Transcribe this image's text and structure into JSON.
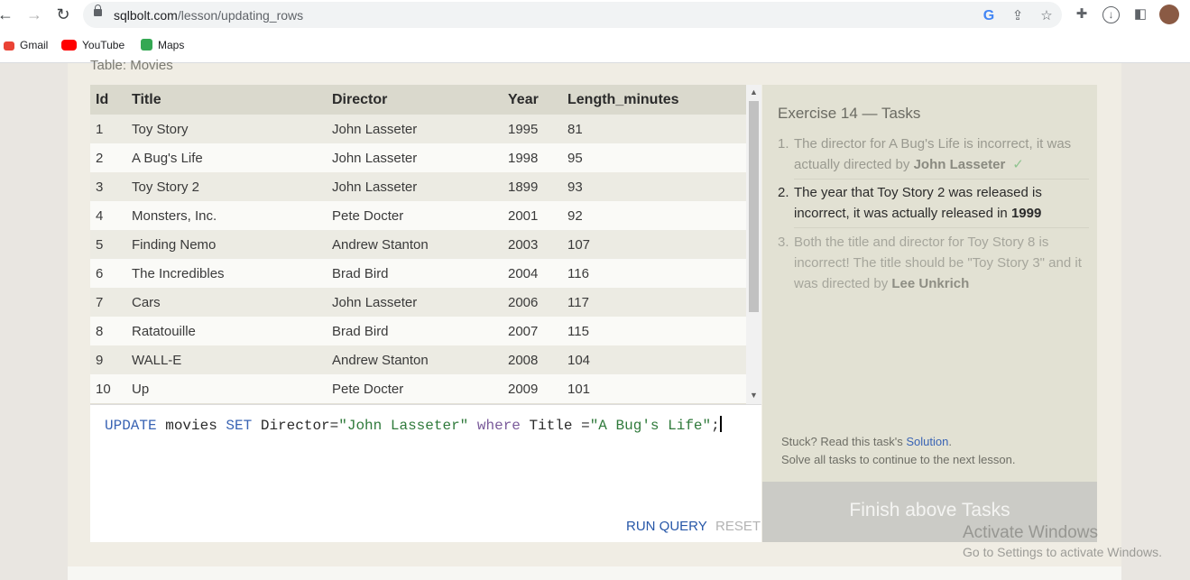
{
  "browser": {
    "url_domain": "sqlbolt.com",
    "url_path": "/lesson/updating_rows",
    "bookmarks": [
      {
        "label": "Gmail",
        "icon": "gmail-icon",
        "color": "#ea4335"
      },
      {
        "label": "YouTube",
        "icon": "youtube-icon",
        "color": "#ff0000"
      },
      {
        "label": "Maps",
        "icon": "maps-icon",
        "color": "#34a853"
      }
    ]
  },
  "table": {
    "label": "Table: Movies",
    "columns": [
      "Id",
      "Title",
      "Director",
      "Year",
      "Length_minutes"
    ],
    "rows": [
      [
        "1",
        "Toy Story",
        "John Lasseter",
        "1995",
        "81"
      ],
      [
        "2",
        "A Bug's Life",
        "John Lasseter",
        "1998",
        "95"
      ],
      [
        "3",
        "Toy Story 2",
        "John Lasseter",
        "1899",
        "93"
      ],
      [
        "4",
        "Monsters, Inc.",
        "Pete Docter",
        "2001",
        "92"
      ],
      [
        "5",
        "Finding Nemo",
        "Andrew Stanton",
        "2003",
        "107"
      ],
      [
        "6",
        "The Incredibles",
        "Brad Bird",
        "2004",
        "116"
      ],
      [
        "7",
        "Cars",
        "John Lasseter",
        "2006",
        "117"
      ],
      [
        "8",
        "Ratatouille",
        "Brad Bird",
        "2007",
        "115"
      ],
      [
        "9",
        "WALL-E",
        "Andrew Stanton",
        "2008",
        "104"
      ],
      [
        "10",
        "Up",
        "Pete Docter",
        "2009",
        "101"
      ]
    ]
  },
  "editor": {
    "kw_update": "UPDATE",
    "t_movies": " movies ",
    "kw_set": "SET",
    "t_director": " Director=",
    "s_director": "\"John Lasseter\"",
    "kw_where": " where",
    "t_title": " Title =",
    "s_title": "\"A Bug's Life\"",
    "t_end": ";",
    "run_label": "RUN QUERY",
    "reset_label": "RESET"
  },
  "tasks": {
    "title": "Exercise 14 — Tasks",
    "items": [
      {
        "num": "1.",
        "text": "The director for A Bug's Life is incorrect, it was actually directed by ",
        "bold": "John Lasseter",
        "check": "✓",
        "state": "done"
      },
      {
        "num": "2.",
        "text": "The year that Toy Story 2 was released is incorrect, it was actually released in ",
        "bold": "1999",
        "state": "current"
      },
      {
        "num": "3.",
        "text": "Both the title and director for Toy Story 8 is incorrect! The title should be \"Toy Story 3\" and it was directed by ",
        "bold": "Lee Unkrich",
        "state": "pending"
      }
    ],
    "stuck_prefix": "Stuck? Read this task's ",
    "solution_link": "Solution",
    "stuck_suffix": ".",
    "solve_all": "Solve all tasks to continue to the next lesson.",
    "finish_label": "Finish above Tasks"
  },
  "watermark": {
    "line1": "Activate Windows",
    "line2": "Go to Settings to activate Windows."
  }
}
